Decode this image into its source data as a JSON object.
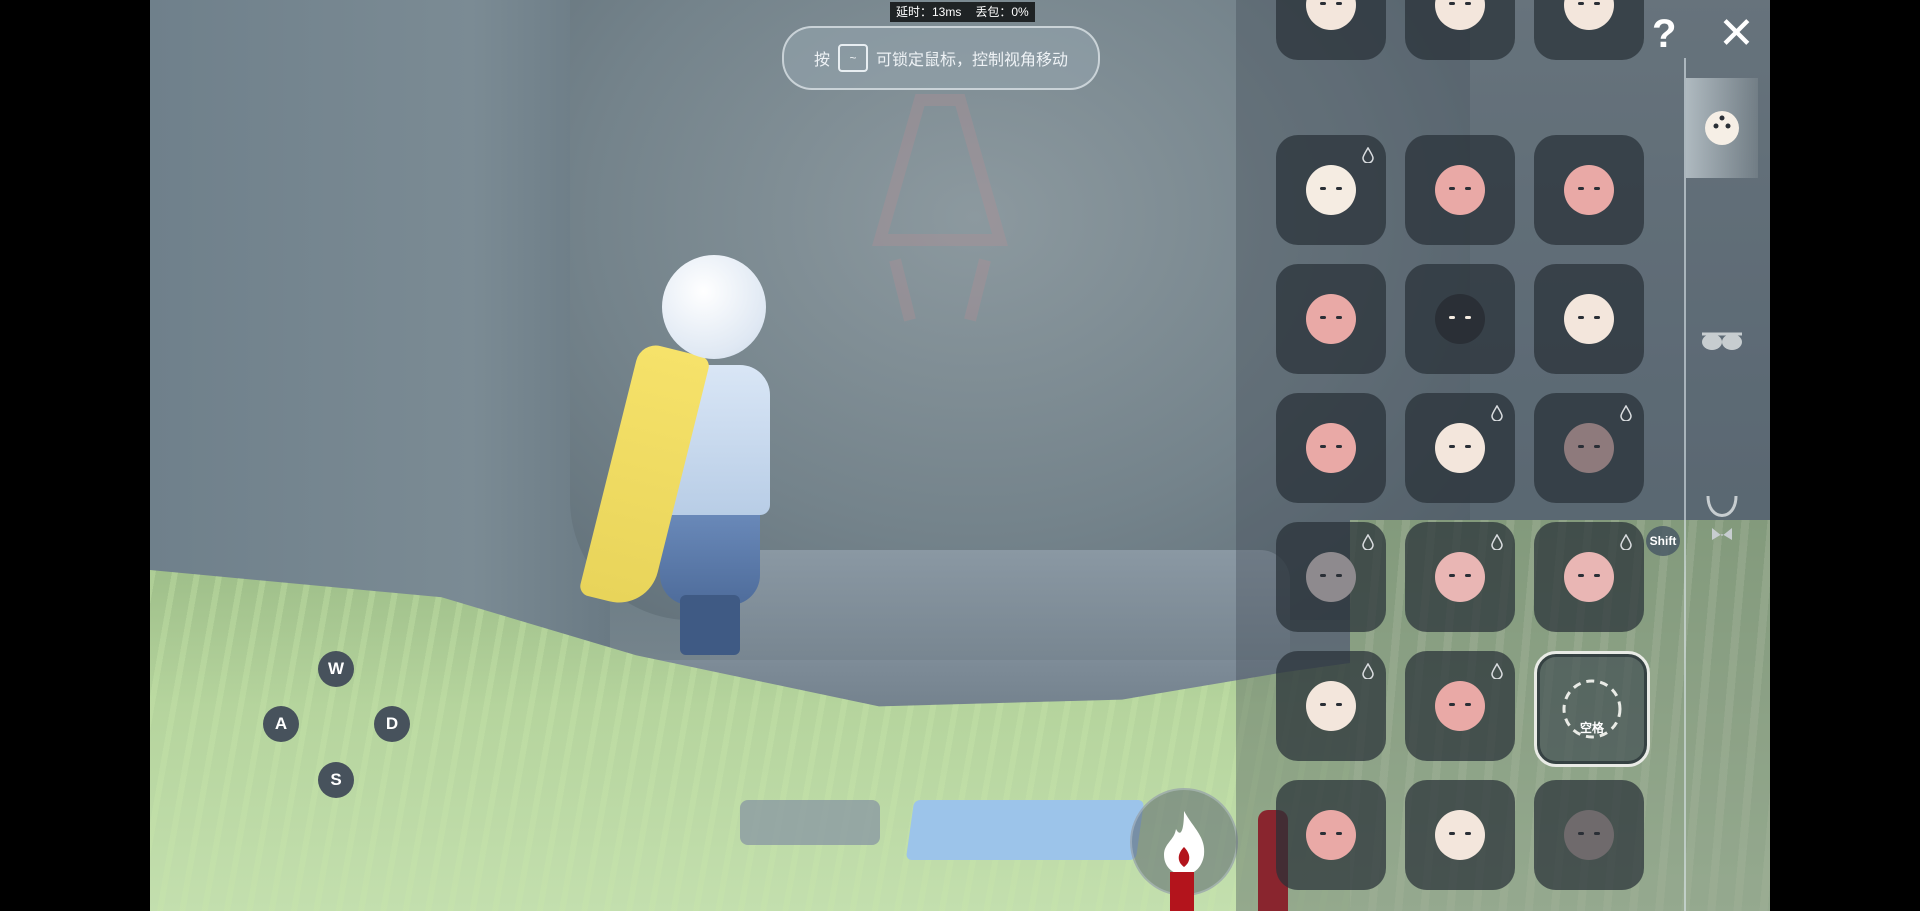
{
  "status": {
    "latency_label": "延时：13ms",
    "loss_label": "丢包：0%"
  },
  "hint": {
    "prefix": "按",
    "key": "~",
    "text": "可锁定鼠标，控制视角移动"
  },
  "controls": {
    "w": "W",
    "a": "A",
    "s": "S",
    "d": "D",
    "shift": "Shift"
  },
  "panel": {
    "help": "?",
    "close": "✕",
    "selected_label": "空格",
    "tabs": [
      "mask-icon",
      "glasses-icon",
      "necklace-icon"
    ],
    "masks": [
      {
        "name": "bearded-mask",
        "tint": "#f3e6dc",
        "drop": false
      },
      {
        "name": "plain-mask-top",
        "tint": "#f3e6dc",
        "drop": false
      },
      {
        "name": "winged-mask",
        "tint": "#f3e6dc",
        "drop": false
      },
      {
        "name": "plain-white-mask",
        "tint": "#f5ece2",
        "drop": true
      },
      {
        "name": "scratch-mask",
        "tint": "#e9a9a6",
        "drop": false
      },
      {
        "name": "star-cheek-mask",
        "tint": "#e9a9a6",
        "drop": false
      },
      {
        "name": "flower-mask",
        "tint": "#e9a9a6",
        "drop": false
      },
      {
        "name": "dark-eyes-mask",
        "tint": "#2a2f36",
        "drop": false
      },
      {
        "name": "tribal-white-mask",
        "tint": "#f3e6dc",
        "drop": false
      },
      {
        "name": "moon-mask",
        "tint": "#e9a9a6",
        "drop": false
      },
      {
        "name": "horned-mask",
        "tint": "#f3e6dc",
        "drop": true
      },
      {
        "name": "bird-mask",
        "tint": "#8e7a7c",
        "drop": true
      },
      {
        "name": "grey-bird-mask",
        "tint": "#8e8a8e",
        "drop": true
      },
      {
        "name": "dragon-mask",
        "tint": "#e9b6b4",
        "drop": true
      },
      {
        "name": "snake-mask",
        "tint": "#e9b6b4",
        "drop": true
      },
      {
        "name": "rose-mask",
        "tint": "#f3e6dc",
        "drop": true
      },
      {
        "name": "gem-mask",
        "tint": "#e9a9a6",
        "drop": true
      },
      {
        "name": "dashed-empty-slot",
        "tint": "none",
        "drop": false,
        "selected": true
      },
      {
        "name": "mustache-mask",
        "tint": "#e9a9a6",
        "drop": false
      },
      {
        "name": "fox-mask",
        "tint": "#f3e6dc",
        "drop": false
      },
      {
        "name": "bandana-mask",
        "tint": "#6f6a6c",
        "drop": false
      }
    ]
  }
}
